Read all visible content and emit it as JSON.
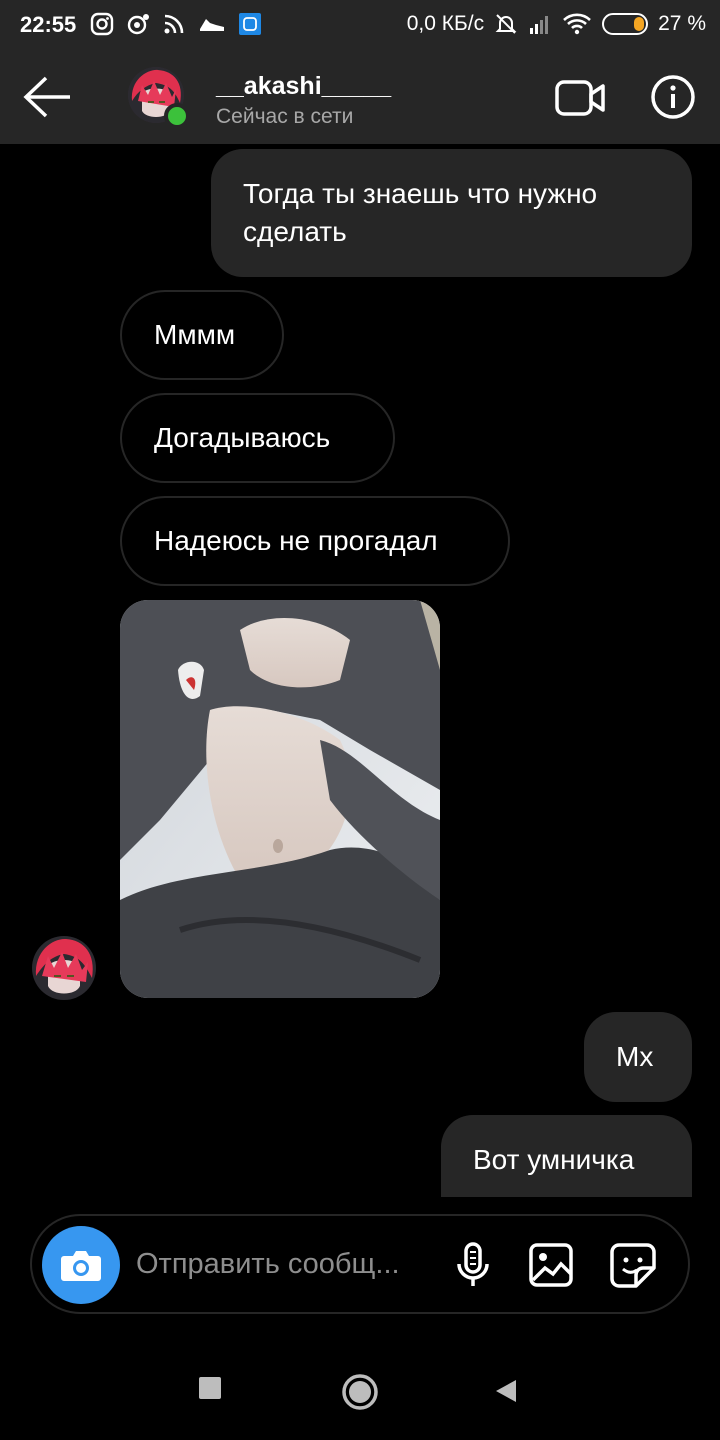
{
  "status_bar": {
    "time": "22:55",
    "network_speed": "0,0 КБ/с",
    "battery_percent": "27 %",
    "battery_level": 0.27,
    "icons": [
      "instagram-icon",
      "notification-icon",
      "rss-icon",
      "shoe-icon",
      "app-icon",
      "mute-icon",
      "signal-icon",
      "wifi-icon",
      "battery-icon"
    ]
  },
  "header": {
    "username": "__akashi_____",
    "status": "Сейчас в сети",
    "online_color": "#3cc13b"
  },
  "messages": [
    {
      "direction": "out",
      "text": "Тогда ты знаешь что нужно сделать"
    },
    {
      "direction": "in",
      "text": "Мммм"
    },
    {
      "direction": "in",
      "text": "Догадываюсь"
    },
    {
      "direction": "in",
      "text": "Надеюсь не прогадал"
    },
    {
      "direction": "in",
      "type": "photo"
    },
    {
      "direction": "out",
      "text": "Мх"
    },
    {
      "direction": "out",
      "text": "Вот умничка"
    }
  ],
  "composer": {
    "placeholder": "Отправить сообщ...",
    "accent_color": "#3797f0"
  },
  "colors": {
    "background": "#000000",
    "bubble_out": "#262626",
    "header": "#262626"
  }
}
